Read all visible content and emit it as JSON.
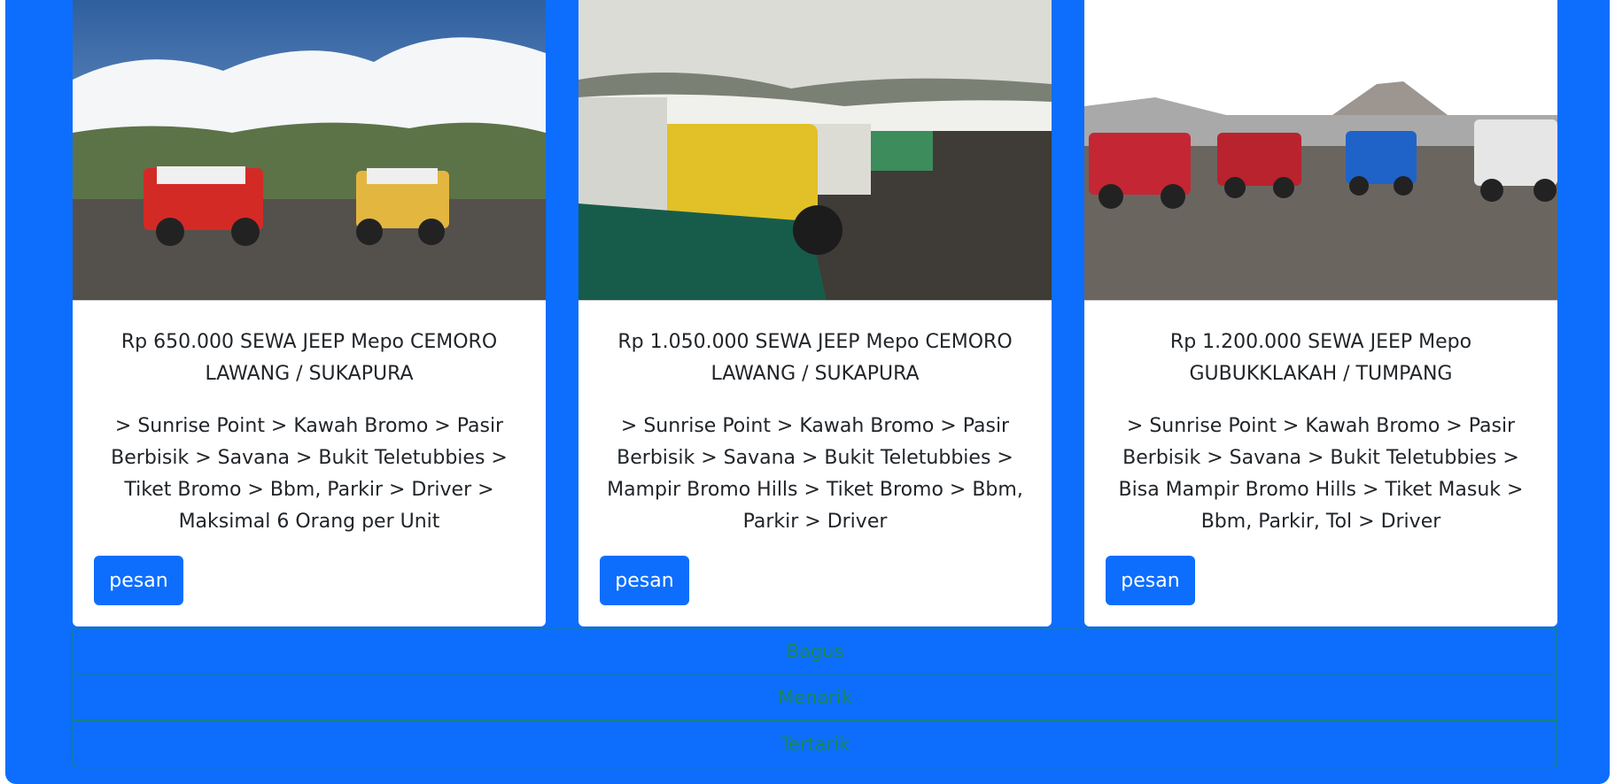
{
  "cards": [
    {
      "title": "Rp 650.000 SEWA JEEP Mepo CEMORO LAWANG / SUKAPURA",
      "description": "> Sunrise Point > Kawah Bromo > Pasir Berbisik > Savana > Bukit Teletubbies > Tiket Bromo > Bbm, Parkir > Driver > Maksimal 6 Orang per Unit",
      "button": "pesan"
    },
    {
      "title": "Rp 1.050.000 SEWA JEEP Mepo CEMORO LAWANG / SUKAPURA",
      "description": "> Sunrise Point > Kawah Bromo > Pasir Berbisik > Savana > Bukit Teletubbies > Mampir Bromo Hills > Tiket Bromo > Bbm, Parkir > Driver",
      "button": "pesan"
    },
    {
      "title": "Rp 1.200.000 SEWA JEEP Mepo GUBUKKLAKAH / TUMPANG",
      "description": "> Sunrise Point > Kawah Bromo > Pasir Berbisik > Savana > Bukit Teletubbies > Bisa Mampir Bromo Hills > Tiket Masuk > Bbm, Parkir, Tol > Driver",
      "button": "pesan"
    }
  ],
  "list": [
    "Bagus",
    "Menarik",
    "Tertarik"
  ],
  "colors": {
    "background": "#0d6efd",
    "button": "#0d6efd",
    "list_text": "#198754"
  }
}
